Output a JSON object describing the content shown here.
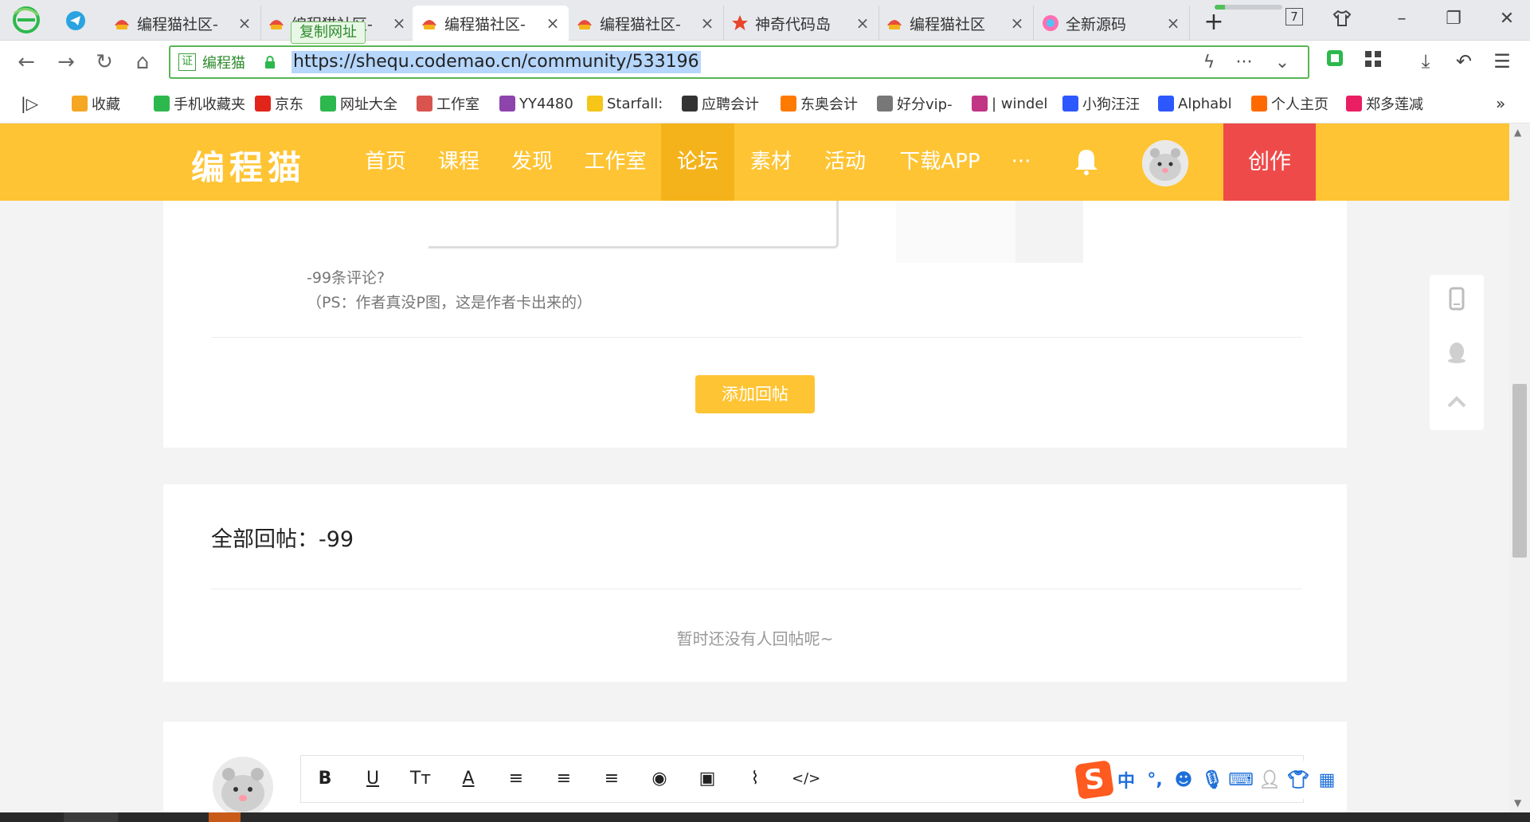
{
  "browser": {
    "tabs": [
      {
        "title": "编程猫社区-",
        "active": false
      },
      {
        "title": "编程猫社区-",
        "active": false
      },
      {
        "title": "编程猫社区-",
        "active": true
      },
      {
        "title": "编程猫社区-",
        "active": false
      },
      {
        "title": "神奇代码岛",
        "active": false
      },
      {
        "title": "编程猫社区",
        "active": false
      },
      {
        "title": "全新源码",
        "active": false
      }
    ],
    "tooltip": "复制网址",
    "tab_count": "7",
    "load_progress_pct": 15,
    "site_name": "编程猫",
    "cert_label": "证",
    "url": "https://shequ.codemao.cn/community/533196",
    "bookmarks": [
      "收藏",
      "手机收藏夹",
      "京东",
      "网址大全",
      "工作室",
      "YY4480",
      "Starfall:",
      "应聘会计",
      "东奥会计",
      "好分vip-",
      "| windel",
      "小狗汪汪",
      "Alphabl",
      "个人主页",
      "郑多莲减"
    ],
    "bookmark_colors": [
      "#f5a623",
      "#2db84d",
      "#e1251b",
      "#2db84d",
      "#d9534f",
      "#8e44ad",
      "#f5c518",
      "#333333",
      "#ff7a00",
      "#777777",
      "#c13584",
      "#2e58ff",
      "#2e58ff",
      "#ff6a00",
      "#e91e63"
    ]
  },
  "site": {
    "logo": "编程猫",
    "nav": [
      "首页",
      "课程",
      "发现",
      "工作室",
      "论坛",
      "素材",
      "活动",
      "下载APP",
      "···"
    ],
    "active_nav": "论坛",
    "create": "创作",
    "colors": {
      "brand": "#fec433",
      "active": "#f5b31b",
      "create": "#ef4a4a"
    }
  },
  "post": {
    "line1": "-99条评论?",
    "line2": "（PS：作者真没P图，这是作者卡出来的）",
    "add_reply": "添加回帖"
  },
  "replies": {
    "title": "全部回帖：-99",
    "empty": "暂时还没有人回帖呢~"
  },
  "editor": {
    "tools": [
      "bold",
      "underline",
      "text-size",
      "font-color",
      "align-left",
      "align-center",
      "align-right",
      "emoji",
      "image",
      "attachment",
      "code"
    ],
    "tool_glyphs": [
      "B",
      "U",
      "Tт",
      "A",
      "≡",
      "≡",
      "≡",
      "◉",
      "▣",
      "⌇",
      "</>"
    ]
  },
  "ime": {
    "logo": "S",
    "lang": "中",
    "punct": "°,"
  }
}
